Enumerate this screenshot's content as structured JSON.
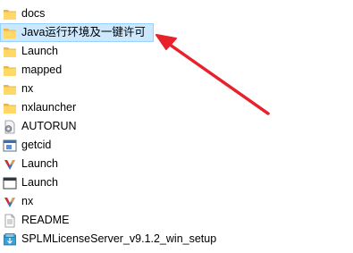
{
  "files": [
    {
      "name": "docs",
      "icon": "folder-icon"
    },
    {
      "name": "Java运行环境及一键许可",
      "icon": "folder-icon",
      "selected": true
    },
    {
      "name": "Launch",
      "icon": "folder-icon"
    },
    {
      "name": "mapped",
      "icon": "folder-icon"
    },
    {
      "name": "nx",
      "icon": "folder-icon"
    },
    {
      "name": "nxlauncher",
      "icon": "folder-icon"
    },
    {
      "name": "AUTORUN",
      "icon": "autorun-settings-icon"
    },
    {
      "name": "getcid",
      "icon": "application-icon"
    },
    {
      "name": "Launch",
      "icon": "nx-app-icon"
    },
    {
      "name": "Launch",
      "icon": "window-app-icon"
    },
    {
      "name": "nx",
      "icon": "nx-app-icon"
    },
    {
      "name": "README",
      "icon": "text-document-icon"
    },
    {
      "name": "SPLMLicenseServer_v9.1.2_win_setup",
      "icon": "installer-icon"
    }
  ],
  "colors": {
    "selection_background": "#cce8ff",
    "selection_border": "#99d1ff",
    "arrow": "#e8222a",
    "folder": "#ffd866"
  }
}
